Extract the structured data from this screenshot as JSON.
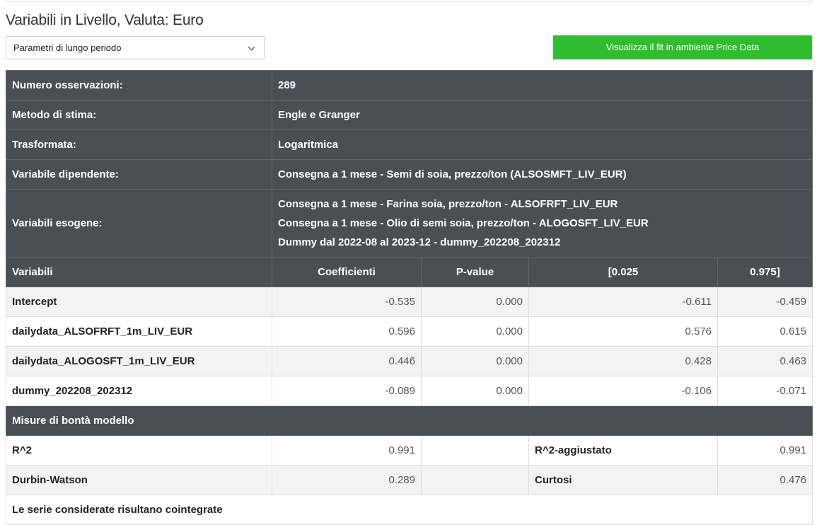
{
  "header": {
    "title": "Variabili in Livello, Valuta: Euro"
  },
  "controls": {
    "select_value": "Parametri di lungo periodo",
    "fit_button_label": "Visualizza il fit in ambiente Price Data",
    "fit_button_color": "#2fbd2f"
  },
  "info": {
    "observations_label": "Numero osservazioni:",
    "observations_value": "289",
    "method_label": "Metodo di stima:",
    "method_value": "Engle e Granger",
    "transform_label": "Trasformata:",
    "transform_value": "Logaritmica",
    "dependent_label": "Variabile dipendente:",
    "dependent_value": "Consegna a 1 mese - Semi di soia, prezzo/ton (ALSOSMFT_LIV_EUR)",
    "exogenous_label": "Variabili esogene:",
    "exogenous": [
      "Consegna a 1 mese - Farina soia, prezzo/ton - ALSOFRFT_LIV_EUR",
      "Consegna a 1 mese - Olio di semi soia, prezzo/ton - ALOGOSFT_LIV_EUR",
      "Dummy dal 2022-08 al 2023-12 - dummy_202208_202312"
    ]
  },
  "coef_table": {
    "headers": [
      "Variabili",
      "Coefficienti",
      "P-value",
      "[0.025",
      "0.975]"
    ],
    "rows": [
      {
        "name": "Intercept",
        "coef": "-0.535",
        "pvalue": "0.000",
        "low": "-0.611",
        "high": "-0.459"
      },
      {
        "name": "dailydata_ALSOFRFT_1m_LIV_EUR",
        "coef": "0.596",
        "pvalue": "0.000",
        "low": "0.576",
        "high": "0.615"
      },
      {
        "name": "dailydata_ALOGOSFT_1m_LIV_EUR",
        "coef": "0.446",
        "pvalue": "0.000",
        "low": "0.428",
        "high": "0.463"
      },
      {
        "name": "dummy_202208_202312",
        "coef": "-0.089",
        "pvalue": "0.000",
        "low": "-0.106",
        "high": "-0.071"
      }
    ]
  },
  "fit": {
    "section_title": "Misure di bontà modello",
    "r2_label": "R^2",
    "r2_value": "0.991",
    "r2adj_label": "R^2-aggiustato",
    "r2adj_value": "0.991",
    "dw_label": "Durbin-Watson",
    "dw_value": "0.289",
    "kurtosis_label": "Curtosi",
    "kurtosis_value": "0.476",
    "conclusion": "Le serie considerate risultano cointegrate"
  },
  "colors": {
    "header_bg": "#4a4f55",
    "row_alt_bg": "#f3f3f3"
  }
}
